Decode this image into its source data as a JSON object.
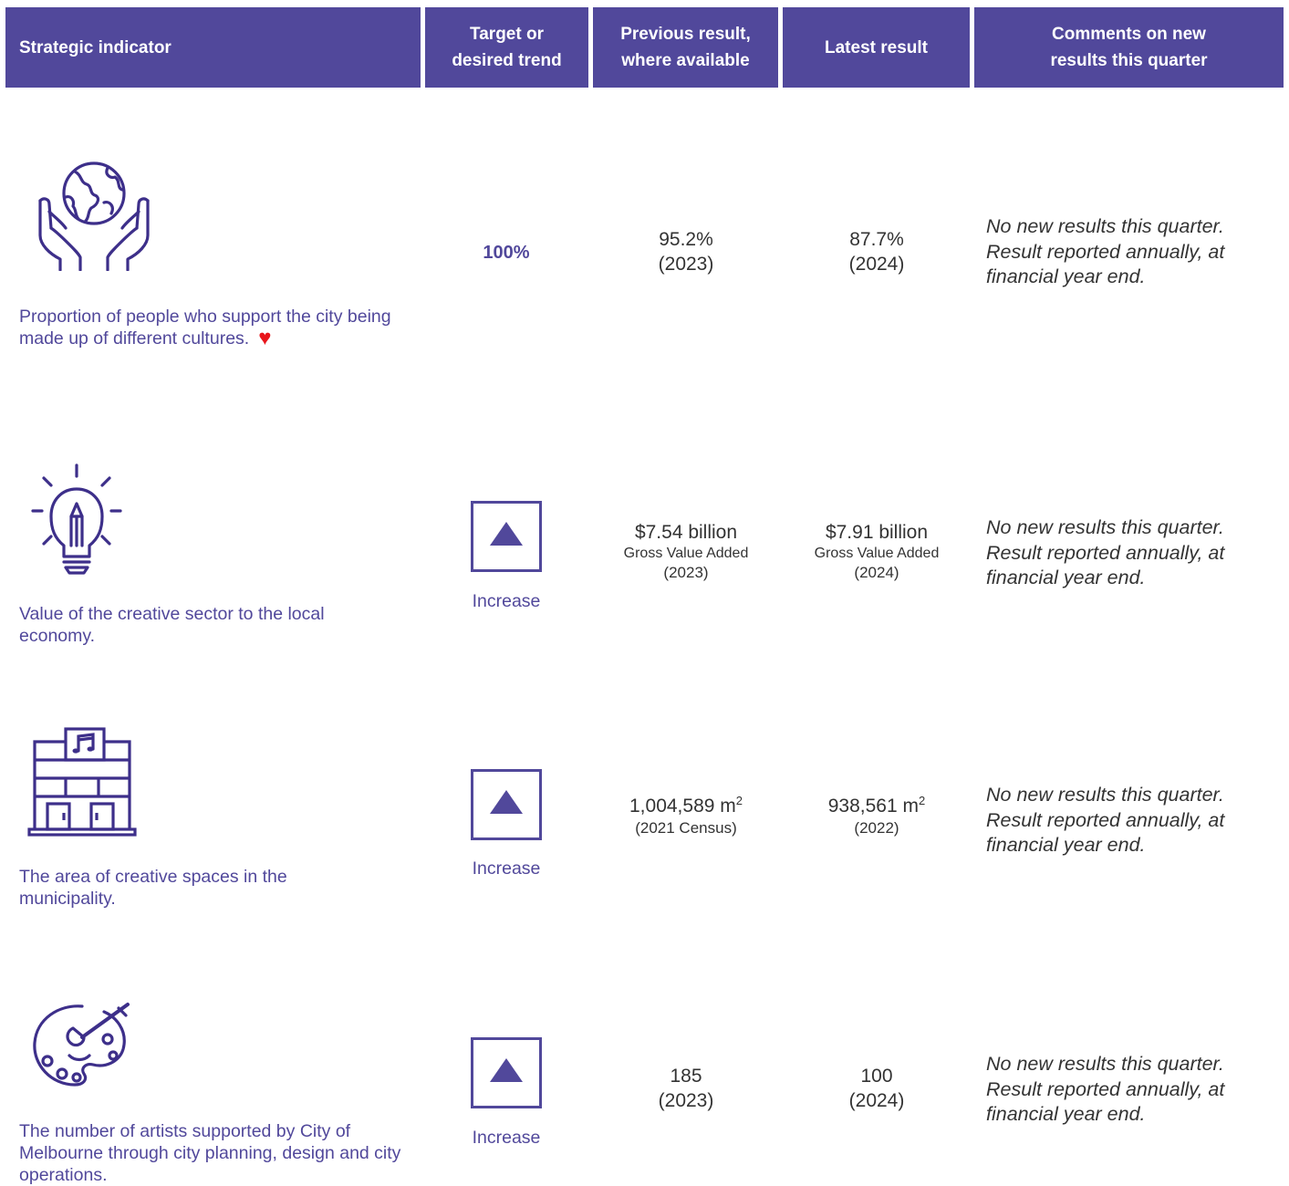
{
  "header": {
    "indicator": "Strategic indicator",
    "target": "Target or\ndesired trend",
    "previous": "Previous result,\nwhere available",
    "latest": "Latest result",
    "comments": "Comments on new\nresults this quarter"
  },
  "colors": {
    "brand": "#51489b",
    "heart": "#e8161c",
    "text": "#333333"
  },
  "rows": [
    {
      "icon": "globe-in-hands-icon",
      "indicator": "Proportion of people who support the city being made up of different cultures.",
      "indicator_mark": "♥",
      "target": "100%",
      "previous": {
        "value": "95.2%",
        "year": "(2023)"
      },
      "latest": {
        "value": "87.7%",
        "year": "(2024)"
      },
      "comment": "No new results this quarter. Result reported annually, at financial year end."
    },
    {
      "icon": "lightbulb-pencil-icon",
      "indicator": "Value of the creative sector to the local economy.",
      "trend_icon": "increase-triangle-icon",
      "trend": "Increase",
      "previous": {
        "value": "$7.54 billion",
        "sub": "Gross Value Added",
        "year": "(2023)"
      },
      "latest": {
        "value": "$7.91 billion",
        "sub": "Gross Value Added",
        "year": "(2024)"
      },
      "comment": "No new results this quarter. Result reported annually, at financial year end."
    },
    {
      "icon": "music-building-icon",
      "indicator": "The area of creative spaces in the municipality.",
      "trend_icon": "increase-triangle-icon",
      "trend": "Increase",
      "previous": {
        "value": "1,004,589 m",
        "unit_sup": "2",
        "year": "(2021 Census)"
      },
      "latest": {
        "value": "938,561 m",
        "unit_sup": "2",
        "year": "(2022)"
      },
      "comment": "No new results this quarter. Result reported annually, at financial year end."
    },
    {
      "icon": "paint-palette-icon",
      "indicator": "The number of artists supported by City of Melbourne through city planning, design and city operations.",
      "trend_icon": "increase-triangle-icon",
      "trend": "Increase",
      "previous": {
        "value": "185",
        "year": "(2023)"
      },
      "latest": {
        "value": "100",
        "year": "(2024)"
      },
      "comment": "No new results this quarter. Result reported annually, at financial year end."
    }
  ]
}
